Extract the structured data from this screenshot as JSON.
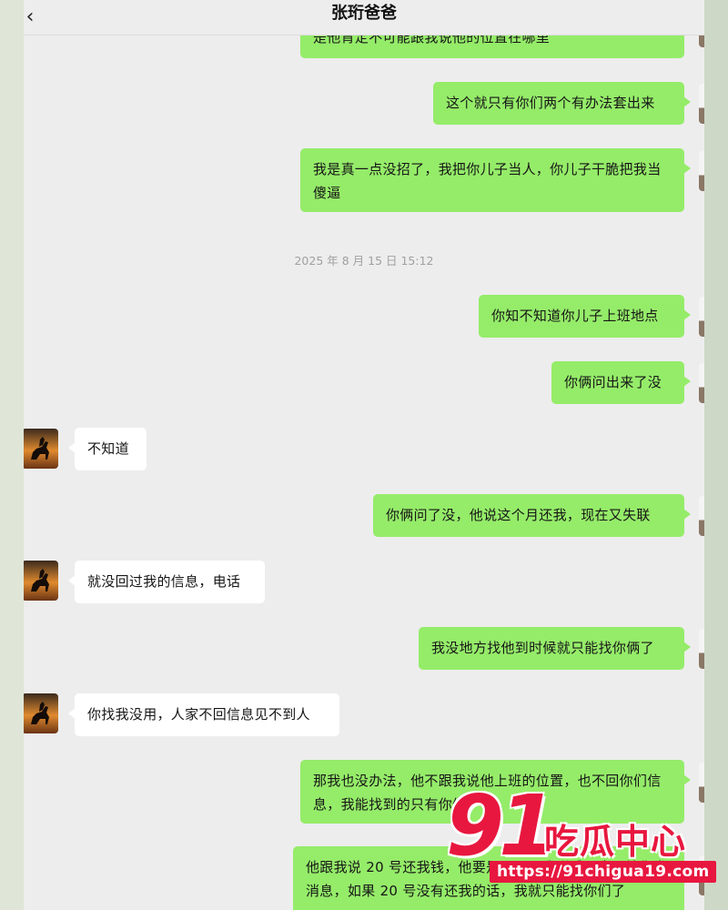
{
  "header": {
    "title": "张珩爸爸",
    "back_icon": "chevron-left-icon"
  },
  "timestamp": "2025 年 8 月 15 日 15:12",
  "messages": [
    {
      "side": "out",
      "text": "是他肯定不可能跟我说他的位置在哪里"
    },
    {
      "side": "out",
      "text": "这个就只有你们两个有办法套出来"
    },
    {
      "side": "out",
      "text": "我是真一点没招了，我把你儿子当人，你儿子干脆把我当傻逼"
    },
    {
      "side": "out",
      "text": "你知不知道你儿子上班地点"
    },
    {
      "side": "out",
      "text": "你俩问出来了没"
    },
    {
      "side": "in",
      "text": "不知道"
    },
    {
      "side": "out",
      "text": "你俩问了没，他说这个月还我，现在又失联"
    },
    {
      "side": "in",
      "text": "就没回过我的信息，电话"
    },
    {
      "side": "out",
      "text": "我没地方找他到时候就只能找你俩了"
    },
    {
      "side": "in",
      "text": "你找我没用，人家不回信息见不到人"
    },
    {
      "side": "out",
      "text": "那我也没办法，他不跟我说他上班的位置，也不回你们信息，我能找到的只有你们"
    },
    {
      "side": "out",
      "text": "他跟我说 20 号还我钱，他要是再不跟我联系，也不给你发消息，如果 20 号没有还我的话，我就只能找你们了"
    }
  ],
  "watermark": {
    "logo_number": "91",
    "logo_text": "吃瓜中心",
    "url": "https://91chigua19.com"
  }
}
